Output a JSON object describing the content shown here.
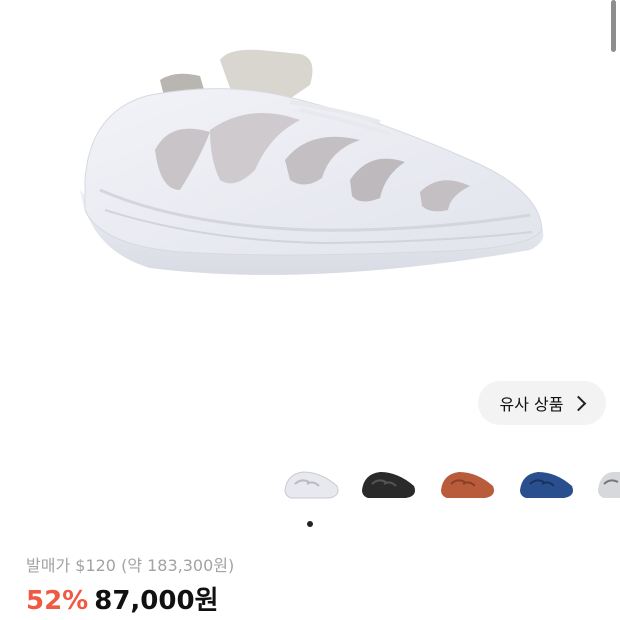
{
  "similar_button": {
    "label": "유사 상품"
  },
  "price": {
    "original_label": "발매가",
    "original_price": "$120",
    "original_converted": "(약 183,300원)",
    "discount": "52%",
    "sale_price": "87,000원"
  },
  "thumbnails": [
    {
      "name": "white",
      "color": "#e8e9ee"
    },
    {
      "name": "black",
      "color": "#2a2a2a"
    },
    {
      "name": "orange-brown",
      "color": "#b85c3c"
    },
    {
      "name": "navy-blue",
      "color": "#2a4f8f"
    },
    {
      "name": "light-gray",
      "color": "#d6d8dc"
    }
  ],
  "colors": {
    "discount": "#ef5a42",
    "muted_text": "#a3a3a3",
    "button_bg": "#f3f3f4"
  }
}
